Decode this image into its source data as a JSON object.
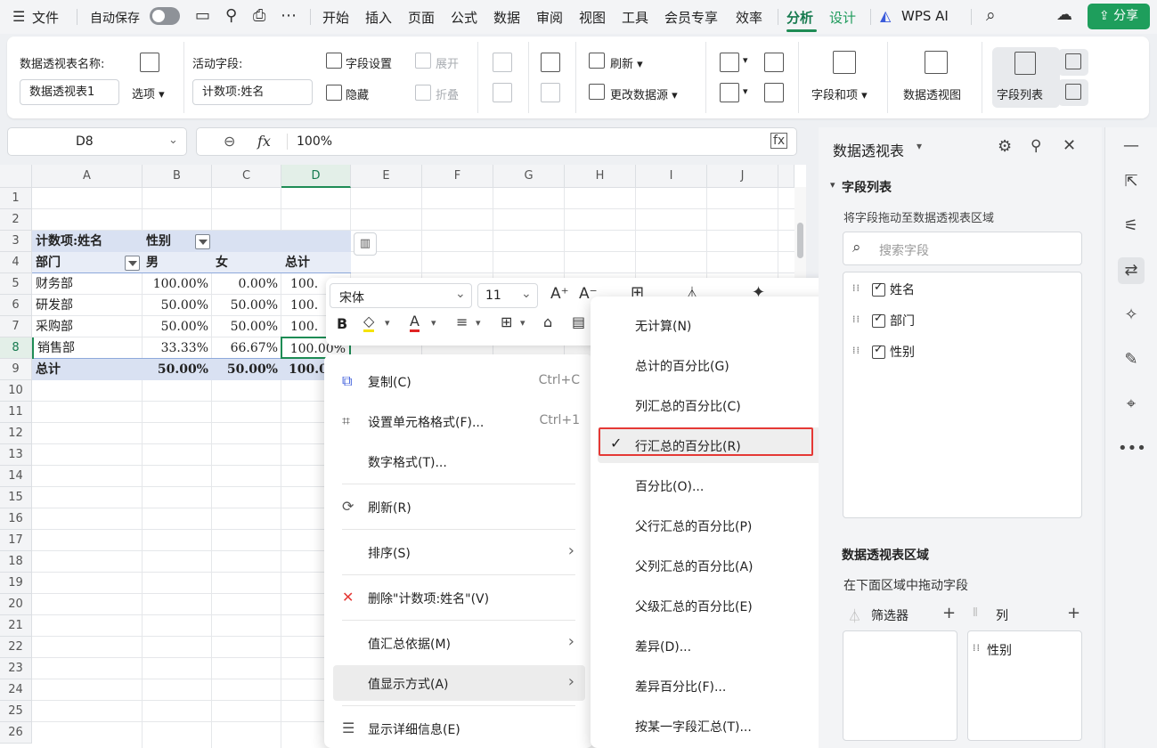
{
  "menubar": {
    "file": "文件",
    "autosave": "自动保存",
    "tabs": [
      "开始",
      "插入",
      "页面",
      "公式",
      "数据",
      "审阅",
      "视图",
      "工具",
      "会员专享",
      "效率",
      "分析",
      "设计"
    ],
    "active_tab": "分析",
    "wps_ai": "WPS AI",
    "share": "分享"
  },
  "ribbon": {
    "pivot_name_label": "数据透视表名称:",
    "pivot_name_value": "数据透视表1",
    "options": "选项",
    "active_field_label": "活动字段:",
    "active_field_value": "计数项:姓名",
    "field_settings": "字段设置",
    "expand": "展开",
    "hide": "隐藏",
    "collapse": "折叠",
    "refresh": "刷新",
    "change_source": "更改数据源",
    "fields_items": "字段和项",
    "pivot_chart": "数据透视图",
    "field_list": "字段列表"
  },
  "formula": {
    "cell_ref": "D8",
    "value": "100%",
    "fx": "fx"
  },
  "grid": {
    "columns": [
      "A",
      "B",
      "C",
      "D",
      "E",
      "F",
      "G",
      "H",
      "I",
      "J"
    ],
    "rows": [
      "1",
      "2",
      "3",
      "4",
      "5",
      "6",
      "7",
      "8",
      "9",
      "10",
      "11",
      "12",
      "13",
      "14",
      "15",
      "16",
      "17",
      "18",
      "19",
      "20",
      "21",
      "22",
      "23",
      "24",
      "25",
      "26"
    ],
    "r3": {
      "a": "计数项:姓名",
      "b": "性别"
    },
    "r4": {
      "a": "部门",
      "b": "男",
      "c": "女",
      "d": "总计"
    },
    "r5": {
      "a": "财务部",
      "b": "100.00%",
      "c": "0.00%",
      "d": "100."
    },
    "r6": {
      "a": "研发部",
      "b": "50.00%",
      "c": "50.00%",
      "d": "100."
    },
    "r7": {
      "a": "采购部",
      "b": "50.00%",
      "c": "50.00%",
      "d": "100."
    },
    "r8": {
      "a": "销售部",
      "b": "33.33%",
      "c": "66.67%",
      "d": "100.00%"
    },
    "r9": {
      "a": "总计",
      "b": "50.00%",
      "c": "50.00%",
      "d": "100.0"
    }
  },
  "minibar": {
    "font": "宋体",
    "size": "11",
    "bold": "B"
  },
  "context_menu": {
    "copy": "复制(C)",
    "copy_sc": "Ctrl+C",
    "format_cells": "设置单元格格式(F)...",
    "format_sc": "Ctrl+1",
    "number_format": "数字格式(T)...",
    "refresh": "刷新(R)",
    "sort": "排序(S)",
    "delete": "删除\"计数项:姓名\"(V)",
    "summarize_by": "值汇总依据(M)",
    "show_values_as": "值显示方式(A)",
    "show_details": "显示详细信息(E)"
  },
  "submenu": {
    "items": [
      "无计算(N)",
      "总计的百分比(G)",
      "列汇总的百分比(C)",
      "行汇总的百分比(R)",
      "百分比(O)...",
      "父行汇总的百分比(P)",
      "父列汇总的百分比(A)",
      "父级汇总的百分比(E)",
      "差异(D)...",
      "差异百分比(F)...",
      "按某一字段汇总(T)..."
    ],
    "checked_index": 3
  },
  "pivot_panel": {
    "title": "数据透视表",
    "field_list": "字段列表",
    "drag_hint": "将字段拖动至数据透视表区域",
    "search_placeholder": "搜索字段",
    "fields": [
      "姓名",
      "部门",
      "性别"
    ],
    "areas_title": "数据透视表区域",
    "areas_hint": "在下面区域中拖动字段",
    "filter_label": "筛选器",
    "column_label": "列",
    "column_field": "性别"
  },
  "colors": {
    "accent_green": "#1e9e5c",
    "pivot_header_blue": "#d9e1f2",
    "highlight_red": "#e53935"
  }
}
